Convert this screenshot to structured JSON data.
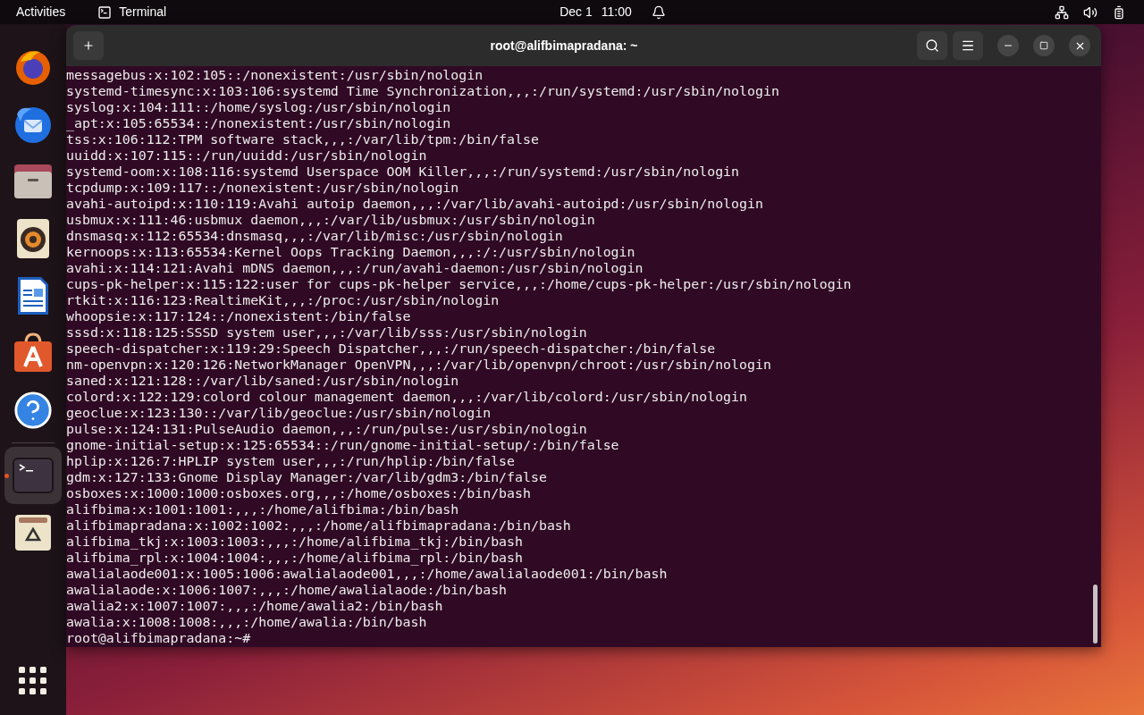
{
  "top_bar": {
    "activities": "Activities",
    "app_name": "Terminal",
    "date": "Dec 1",
    "time": "11:00"
  },
  "dock": [
    {
      "kind": "browser",
      "running": false,
      "selected": false
    },
    {
      "kind": "mail",
      "running": false,
      "selected": false
    },
    {
      "kind": "files",
      "running": false,
      "selected": false
    },
    {
      "kind": "music",
      "running": false,
      "selected": false
    },
    {
      "kind": "writer",
      "running": false,
      "selected": false
    },
    {
      "kind": "store",
      "running": false,
      "selected": false
    },
    {
      "kind": "help",
      "running": false,
      "selected": false
    },
    {
      "kind": "terminal",
      "running": true,
      "selected": true
    },
    {
      "kind": "trash",
      "running": false,
      "selected": false
    }
  ],
  "window": {
    "title": "root@alifbimapradana: ~"
  },
  "terminal_lines": [
    "messagebus:x:102:105::/nonexistent:/usr/sbin/nologin",
    "systemd-timesync:x:103:106:systemd Time Synchronization,,,:/run/systemd:/usr/sbin/nologin",
    "syslog:x:104:111::/home/syslog:/usr/sbin/nologin",
    "_apt:x:105:65534::/nonexistent:/usr/sbin/nologin",
    "tss:x:106:112:TPM software stack,,,:/var/lib/tpm:/bin/false",
    "uuidd:x:107:115::/run/uuidd:/usr/sbin/nologin",
    "systemd-oom:x:108:116:systemd Userspace OOM Killer,,,:/run/systemd:/usr/sbin/nologin",
    "tcpdump:x:109:117::/nonexistent:/usr/sbin/nologin",
    "avahi-autoipd:x:110:119:Avahi autoip daemon,,,:/var/lib/avahi-autoipd:/usr/sbin/nologin",
    "usbmux:x:111:46:usbmux daemon,,,:/var/lib/usbmux:/usr/sbin/nologin",
    "dnsmasq:x:112:65534:dnsmasq,,,:/var/lib/misc:/usr/sbin/nologin",
    "kernoops:x:113:65534:Kernel Oops Tracking Daemon,,,:/:/usr/sbin/nologin",
    "avahi:x:114:121:Avahi mDNS daemon,,,:/run/avahi-daemon:/usr/sbin/nologin",
    "cups-pk-helper:x:115:122:user for cups-pk-helper service,,,:/home/cups-pk-helper:/usr/sbin/nologin",
    "rtkit:x:116:123:RealtimeKit,,,:/proc:/usr/sbin/nologin",
    "whoopsie:x:117:124::/nonexistent:/bin/false",
    "sssd:x:118:125:SSSD system user,,,:/var/lib/sss:/usr/sbin/nologin",
    "speech-dispatcher:x:119:29:Speech Dispatcher,,,:/run/speech-dispatcher:/bin/false",
    "nm-openvpn:x:120:126:NetworkManager OpenVPN,,,:/var/lib/openvpn/chroot:/usr/sbin/nologin",
    "saned:x:121:128::/var/lib/saned:/usr/sbin/nologin",
    "colord:x:122:129:colord colour management daemon,,,:/var/lib/colord:/usr/sbin/nologin",
    "geoclue:x:123:130::/var/lib/geoclue:/usr/sbin/nologin",
    "pulse:x:124:131:PulseAudio daemon,,,:/run/pulse:/usr/sbin/nologin",
    "gnome-initial-setup:x:125:65534::/run/gnome-initial-setup/:/bin/false",
    "hplip:x:126:7:HPLIP system user,,,:/run/hplip:/bin/false",
    "gdm:x:127:133:Gnome Display Manager:/var/lib/gdm3:/bin/false",
    "osboxes:x:1000:1000:osboxes.org,,,:/home/osboxes:/bin/bash",
    "alifbima:x:1001:1001:,,,:/home/alifbima:/bin/bash",
    "alifbimapradana:x:1002:1002:,,,:/home/alifbimapradana:/bin/bash",
    "alifbima_tkj:x:1003:1003:,,,:/home/alifbima_tkj:/bin/bash",
    "alifbima_rpl:x:1004:1004:,,,:/home/alifbima_rpl:/bin/bash",
    "awalialaode001:x:1005:1006:awalialaode001,,,:/home/awalialaode001:/bin/bash",
    "awalialaode:x:1006:1007:,,,:/home/awalialaode:/bin/bash",
    "awalia2:x:1007:1007:,,,:/home/awalia2:/bin/bash",
    "awalia:x:1008:1008:,,,:/home/awalia:/bin/bash"
  ],
  "prompt": "root@alifbimapradana:~#"
}
